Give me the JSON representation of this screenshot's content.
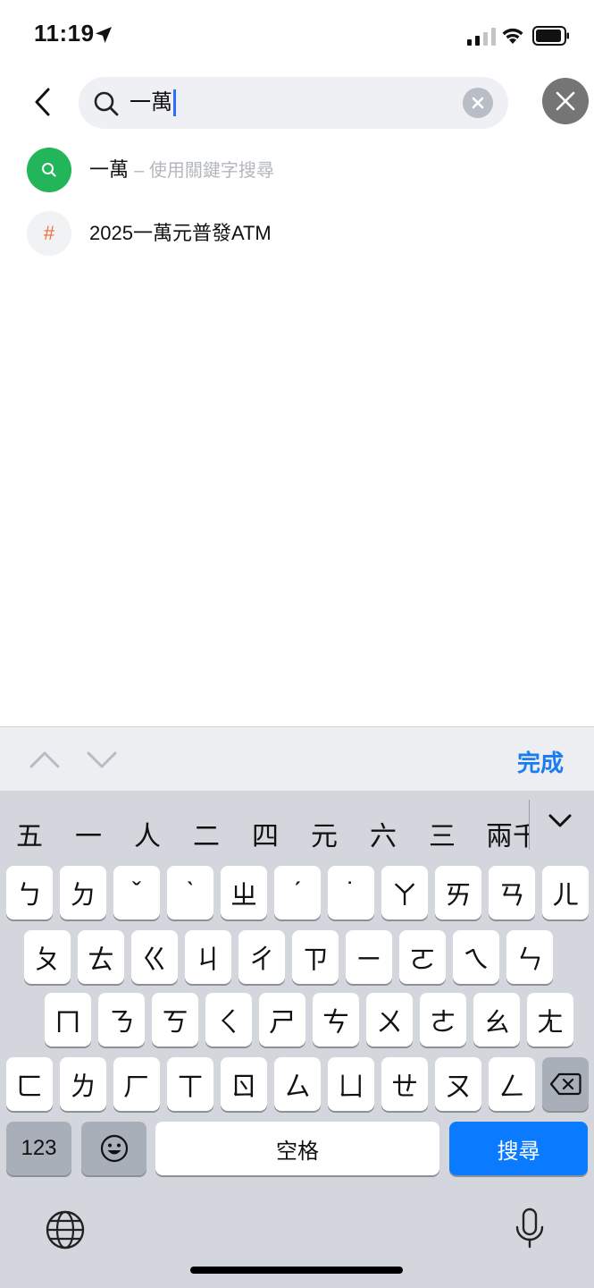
{
  "status_bar": {
    "time": "11:19",
    "icons": [
      "location-arrow-icon",
      "cellular-signal-icon",
      "wifi-icon",
      "battery-icon"
    ]
  },
  "search": {
    "query": "一萬",
    "icons": [
      "back-chevron-icon",
      "search-icon",
      "clear-icon",
      "close-icon"
    ]
  },
  "suggestions": [
    {
      "text": "一萬",
      "hint": "– 使用關鍵字搜尋",
      "icon": "search-icon",
      "icon_color": "#22b55a"
    },
    {
      "text": "2025一萬元普發ATM",
      "hint": "",
      "icon": "hashtag-icon",
      "icon_color": "#f26b3a"
    }
  ],
  "accessory_bar": {
    "done_label": "完成"
  },
  "keyboard": {
    "candidates": [
      "五",
      "一",
      "人",
      "二",
      "四",
      "元",
      "六",
      "三",
      "兩千"
    ],
    "rows": [
      [
        "ㄅ",
        "ㄉ",
        "ˇ",
        "ˋ",
        "ㄓ",
        "ˊ",
        "˙",
        "ㄚ",
        "ㄞ",
        "ㄢ",
        "ㄦ"
      ],
      [
        "ㄆ",
        "ㄊ",
        "ㄍ",
        "ㄐ",
        "ㄔ",
        "ㄗ",
        "ㄧ",
        "ㄛ",
        "ㄟ",
        "ㄣ"
      ],
      [
        "ㄇ",
        "ㄋ",
        "ㄎ",
        "ㄑ",
        "ㄕ",
        "ㄘ",
        "ㄨ",
        "ㄜ",
        "ㄠ",
        "ㄤ"
      ],
      [
        "ㄈ",
        "ㄌ",
        "ㄏ",
        "ㄒ",
        "ㄖ",
        "ㄙ",
        "ㄩ",
        "ㄝ",
        "ㄡ",
        "ㄥ"
      ]
    ],
    "numbers_label": "123",
    "space_label": "空格",
    "search_label": "搜尋",
    "accent_color": "#0a7bff"
  }
}
